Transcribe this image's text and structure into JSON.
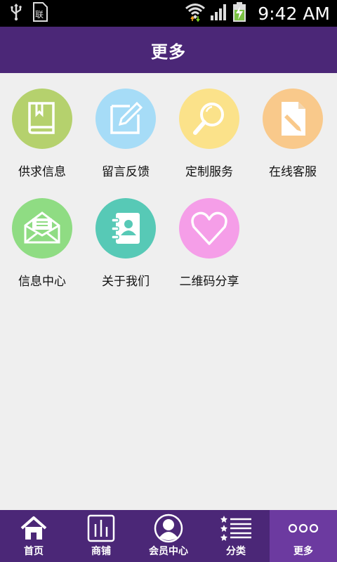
{
  "status_bar": {
    "time": "9:42 AM",
    "icons": [
      "usb-icon",
      "sim-card-icon",
      "wifi-icon",
      "signal-icon",
      "battery-charging-icon"
    ]
  },
  "header": {
    "title": "更多"
  },
  "tiles": [
    {
      "label": "供求信息",
      "icon": "book-icon",
      "color": "#b5d16d"
    },
    {
      "label": "留言反馈",
      "icon": "edit-icon",
      "color": "#a6dcf7"
    },
    {
      "label": "定制服务",
      "icon": "search-icon",
      "color": "#fbe28a"
    },
    {
      "label": "在线客服",
      "icon": "document-edit-icon",
      "color": "#f9c98b"
    },
    {
      "label": "信息中心",
      "icon": "envelope-icon",
      "color": "#8fdc83"
    },
    {
      "label": "关于我们",
      "icon": "contacts-icon",
      "color": "#57c9b6"
    },
    {
      "label": "二维码分享",
      "icon": "heart-icon",
      "color": "#f59ee8"
    }
  ],
  "bottom_nav": {
    "items": [
      {
        "label": "首页",
        "icon": "home-icon"
      },
      {
        "label": "商铺",
        "icon": "shop-icon"
      },
      {
        "label": "会员中心",
        "icon": "member-icon"
      },
      {
        "label": "分类",
        "icon": "category-list-icon"
      },
      {
        "label": "更多",
        "icon": "more-dots-icon",
        "active": true
      }
    ]
  },
  "colors": {
    "primary": "#4b2777",
    "active_tab": "#6c3aa0",
    "background": "#efefef"
  }
}
